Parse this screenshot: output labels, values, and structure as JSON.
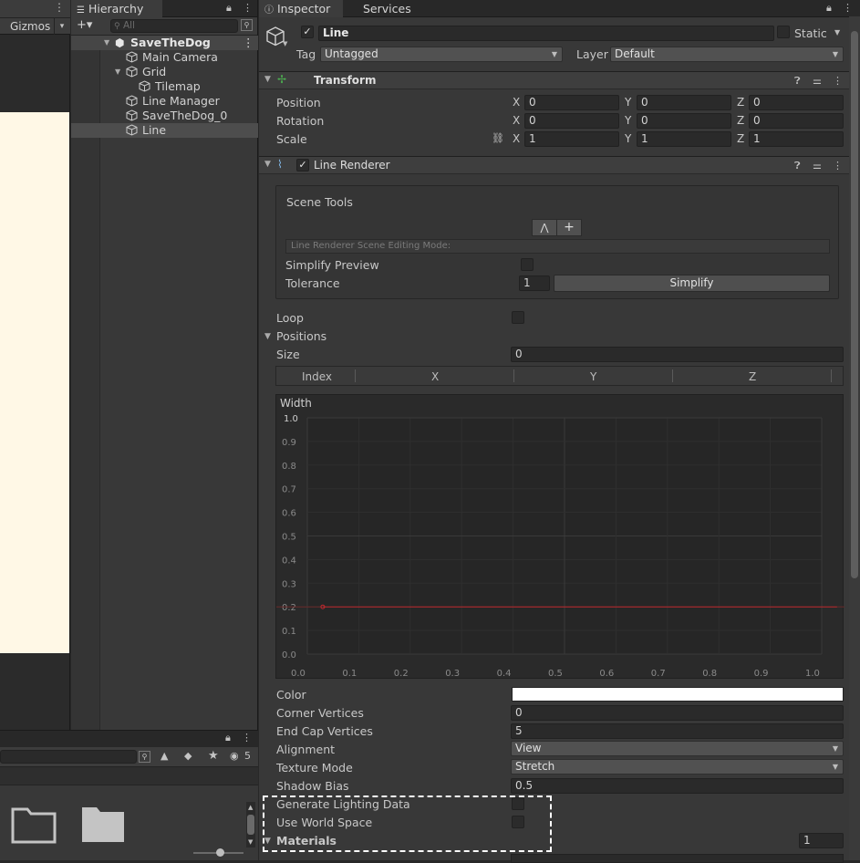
{
  "scene": {
    "gizmos": "Gizmos",
    "gizmos_arrow": "▾",
    "menu": "⋮"
  },
  "hierarchy": {
    "tab": "Hierarchy",
    "add": "+▾",
    "search_placeholder": "All",
    "items": [
      {
        "label": "SaveTheDog",
        "expanded": true,
        "level": 0,
        "bold": true
      },
      {
        "label": "Main Camera",
        "level": 1
      },
      {
        "label": "Grid",
        "expanded": true,
        "level": 1
      },
      {
        "label": "Tilemap",
        "level": 2
      },
      {
        "label": "Line Manager",
        "level": 1
      },
      {
        "label": "SaveTheDog_0",
        "level": 1
      },
      {
        "label": "Line",
        "level": 1,
        "selected": true
      }
    ]
  },
  "project": {
    "hidden_count": "5"
  },
  "inspector": {
    "tabs": [
      "Inspector",
      "Services"
    ],
    "object": {
      "name": "Line",
      "static_label": "Static",
      "tag_label": "Tag",
      "tag": "Untagged",
      "layer_label": "Layer",
      "layer": "Default"
    },
    "transform": {
      "title": "Transform",
      "rows": [
        {
          "label": "Position",
          "x": "0",
          "y": "0",
          "z": "0"
        },
        {
          "label": "Rotation",
          "x": "0",
          "y": "0",
          "z": "0"
        },
        {
          "label": "Scale",
          "x": "1",
          "y": "1",
          "z": "1"
        }
      ]
    },
    "line_renderer": {
      "title": "Line Renderer",
      "scene_tools": "Scene Tools",
      "editing_mode": "Line Renderer Scene Editing Mode:",
      "simplify_preview": "Simplify Preview",
      "tolerance_label": "Tolerance",
      "tolerance": "1",
      "simplify_button": "Simplify",
      "loop": "Loop",
      "positions": "Positions",
      "size_label": "Size",
      "size": "0",
      "columns": [
        "Index",
        "X",
        "Y",
        "Z"
      ],
      "width_label": "Width",
      "width_top": "1.0",
      "y_ticks": [
        "0.9",
        "0.8",
        "0.7",
        "0.6",
        "0.5",
        "0.4",
        "0.3",
        "0.2",
        "0.1",
        "0.0"
      ],
      "x_ticks": [
        "0.0",
        "0.1",
        "0.2",
        "0.3",
        "0.4",
        "0.5",
        "0.6",
        "0.7",
        "0.8",
        "0.9",
        "1.0"
      ],
      "color_label": "Color",
      "color_value": "#ffffff",
      "corner_label": "Corner Vertices",
      "corner": "0",
      "endcap_label": "End Cap Vertices",
      "endcap": "5",
      "alignment_label": "Alignment",
      "alignment": "View",
      "texture_label": "Texture Mode",
      "texture": "Stretch",
      "shadow_label": "Shadow Bias",
      "shadow": "0.5",
      "lighting_label": "Generate Lighting Data",
      "world_label": "Use World Space",
      "materials_label": "Materials",
      "materials": "1"
    }
  },
  "chart_data": {
    "type": "line",
    "title": "Width",
    "x": [
      0.03,
      1.03
    ],
    "series": [
      {
        "values": [
          0.2,
          0.2
        ]
      }
    ],
    "xlim": [
      0,
      1.05
    ],
    "ylim": [
      0,
      1.0
    ],
    "grid": true,
    "line_color": "#c0282d"
  }
}
